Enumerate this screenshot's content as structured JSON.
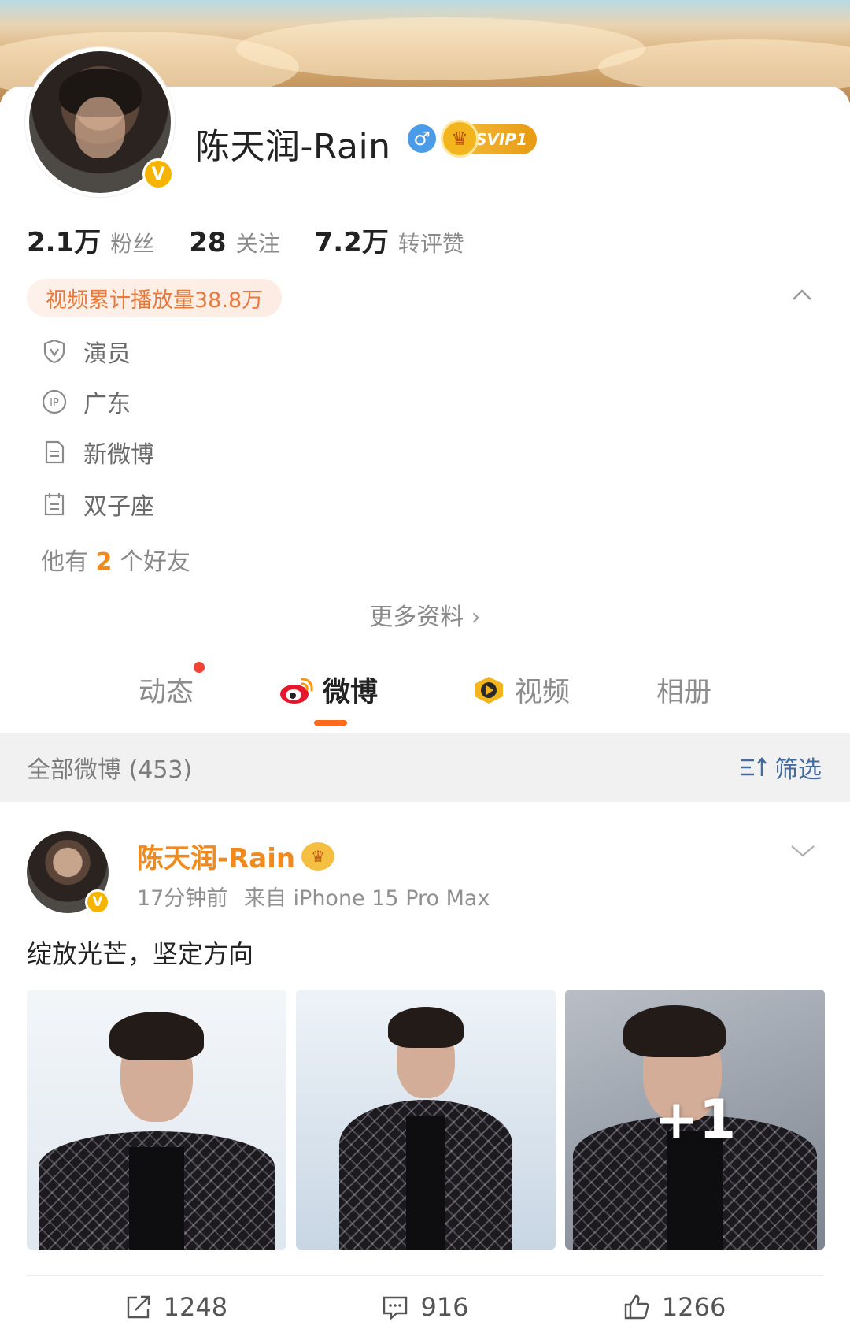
{
  "profile": {
    "name": "陈天润-Rain",
    "gender_icon": "male-icon",
    "vip_label": "SVIP1",
    "stats": [
      {
        "value": "2.1万",
        "label": "粉丝"
      },
      {
        "value": "28",
        "label": "关注"
      },
      {
        "value": "7.2万",
        "label": "转评赞"
      }
    ],
    "play_count": "视频累计播放量38.8万",
    "info": [
      {
        "icon": "verified-shield-icon",
        "text": "演员"
      },
      {
        "icon": "ip-location-icon",
        "text": "广东"
      },
      {
        "icon": "document-icon",
        "text": "新微博"
      },
      {
        "icon": "calendar-icon",
        "text": "双子座"
      }
    ],
    "friends_prefix": "他有",
    "friends_count": "2",
    "friends_suffix": "个好友",
    "more_info": "更多资料"
  },
  "tabs": [
    {
      "label": "动态",
      "has_dot": true
    },
    {
      "label": "微博",
      "active": true
    },
    {
      "label": "视频"
    },
    {
      "label": "相册"
    }
  ],
  "feed": {
    "count_label": "全部微博 (453)",
    "filter_label": "筛选"
  },
  "post": {
    "author": "陈天润-Rain",
    "time": "17分钟前",
    "source": "来自 iPhone 15 Pro Max",
    "text": "绽放光芒，坚定方向",
    "more_photos": "+1",
    "repost_count": "1248",
    "comment_count": "916",
    "like_count": "1266"
  },
  "colors": {
    "accent_orange": "#ff6b1a",
    "name_orange": "#f08a1c",
    "verified_gold": "#f4b400",
    "filter_blue": "#436b9e",
    "notification_red": "#f14336"
  }
}
